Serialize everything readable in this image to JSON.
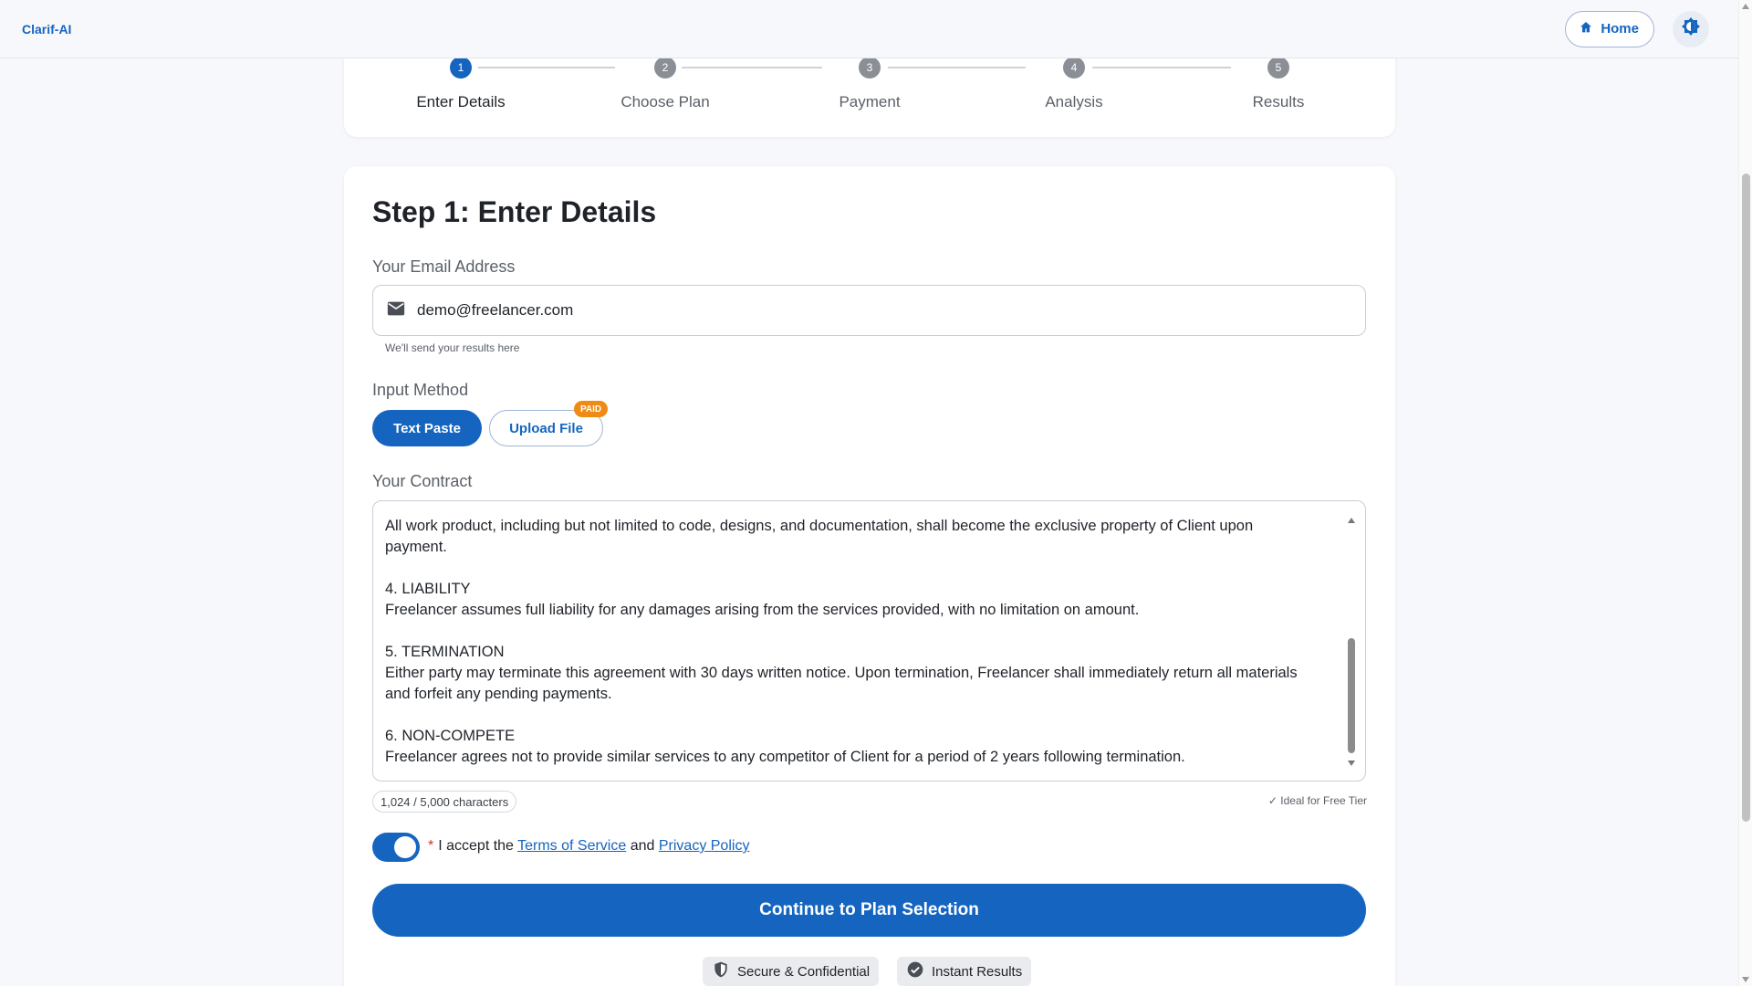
{
  "app": {
    "brand": "Clarif-AI"
  },
  "header": {
    "home_label": "Home"
  },
  "stepper": {
    "steps": [
      {
        "number": "1",
        "label": "Enter Details"
      },
      {
        "number": "2",
        "label": "Choose Plan"
      },
      {
        "number": "3",
        "label": "Payment"
      },
      {
        "number": "4",
        "label": "Analysis"
      },
      {
        "number": "5",
        "label": "Results"
      }
    ]
  },
  "form": {
    "title": "Step 1: Enter Details",
    "email_label": "Your Email Address",
    "email_value": "demo@freelancer.com",
    "email_helper": "We'll send your results here",
    "input_method_label": "Input Method",
    "method_text_paste": "Text Paste",
    "method_upload_file": "Upload File",
    "paid_badge": "PAID",
    "contract_label": "Your Contract",
    "contract_text": "All work product, including but not limited to code, designs, and documentation, shall become the exclusive property of Client upon\npayment.\n\n4. LIABILITY\nFreelancer assumes full liability for any damages arising from the services provided, with no limitation on amount.\n\n5. TERMINATION\nEither party may terminate this agreement with 30 days written notice. Upon termination, Freelancer shall immediately return all materials\nand forfeit any pending payments.\n\n6. NON-COMPETE\nFreelancer agrees not to provide similar services to any competitor of Client for a period of 2 years following termination.",
    "char_count": "1,024 / 5,000 characters",
    "tier_note": "✓ Ideal for Free Tier",
    "terms_required_mark": "*",
    "terms_prefix": "I accept the",
    "terms_link": "Terms of Service",
    "terms_and": "and",
    "privacy_link": "Privacy Policy",
    "continue_label": "Continue to Plan Selection"
  },
  "badges": {
    "secure": "Secure & Confidential",
    "instant": "Instant Results"
  },
  "colors": {
    "accent": "#1565c0",
    "paid": "#ef8a14"
  },
  "icons": [
    "home-icon",
    "theme-toggle-icon",
    "email-icon",
    "shield-icon",
    "check-circle-icon"
  ]
}
